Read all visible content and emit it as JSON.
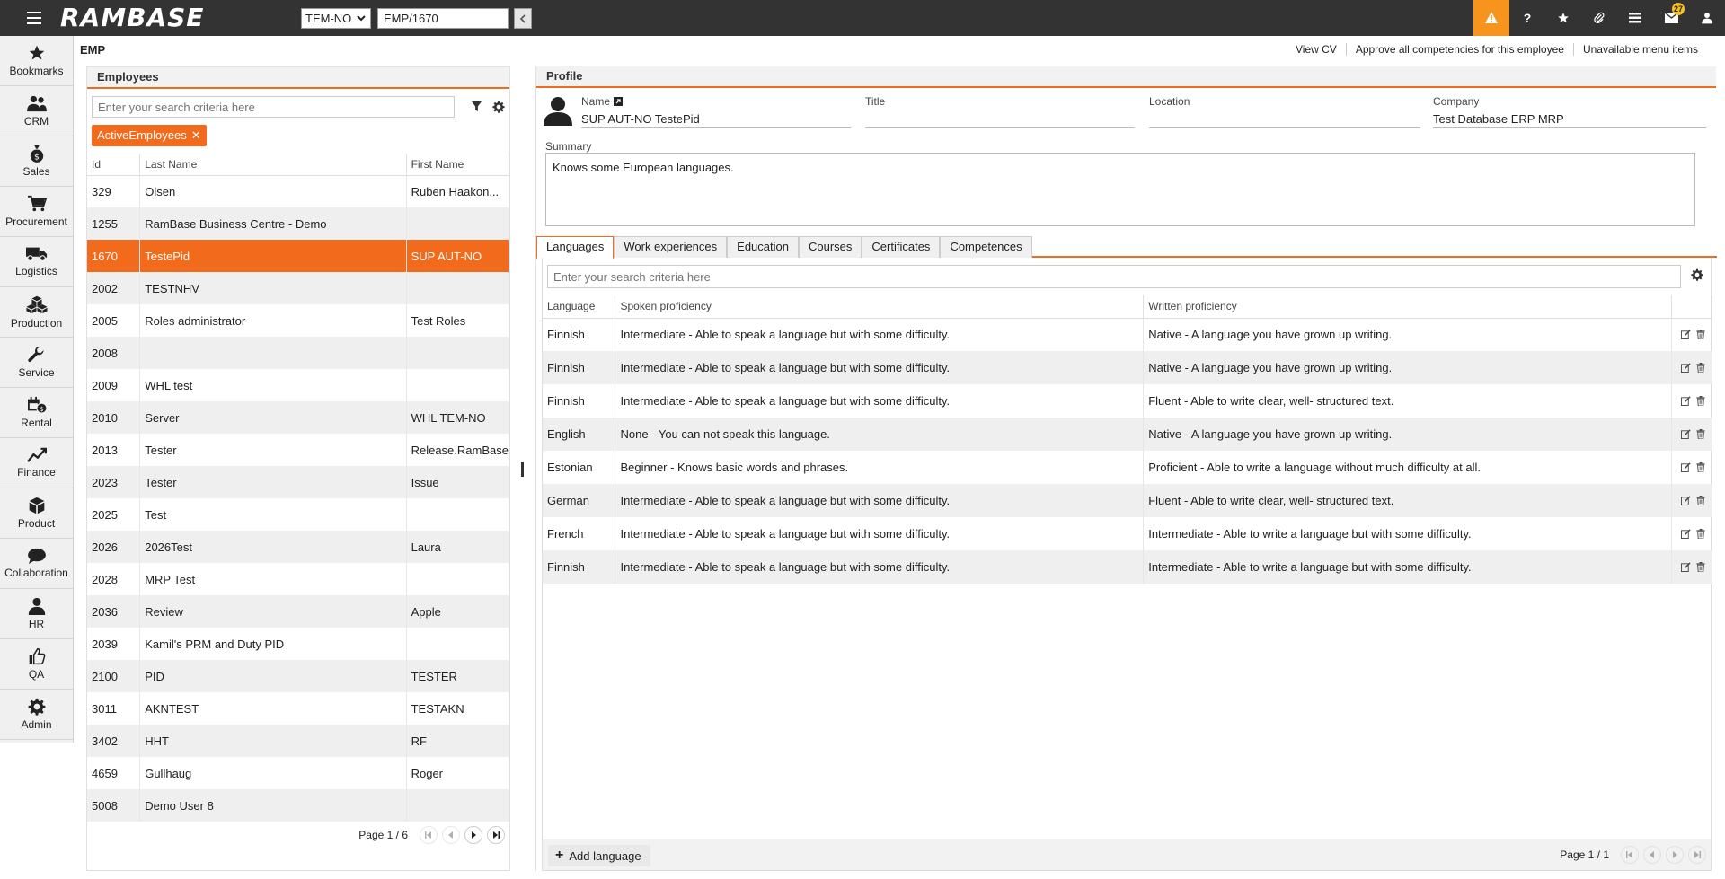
{
  "app": {
    "logo": "RAMBASE",
    "company": "TEM-NO",
    "goto_value": "EMP/1670",
    "notifications_count": "27"
  },
  "nav": [
    {
      "label": "Bookmarks",
      "icon": "star-icon"
    },
    {
      "label": "CRM",
      "icon": "people-icon"
    },
    {
      "label": "Sales",
      "icon": "money-bag-icon"
    },
    {
      "label": "Procurement",
      "icon": "cart-icon"
    },
    {
      "label": "Logistics",
      "icon": "truck-icon"
    },
    {
      "label": "Production",
      "icon": "boxes-icon"
    },
    {
      "label": "Service",
      "icon": "wrench-icon"
    },
    {
      "label": "Rental",
      "icon": "rental-icon"
    },
    {
      "label": "Finance",
      "icon": "chart-icon"
    },
    {
      "label": "Product",
      "icon": "box-icon"
    },
    {
      "label": "Collaboration",
      "icon": "chat-icon"
    },
    {
      "label": "HR",
      "icon": "person-icon"
    },
    {
      "label": "QA",
      "icon": "thumbs-up-icon"
    },
    {
      "label": "Admin",
      "icon": "gear-icon"
    }
  ],
  "page": {
    "code": "EMP",
    "menu_links": [
      "View CV",
      "Approve all competencies for this employee",
      "Unavailable menu items"
    ]
  },
  "employees": {
    "title": "Employees",
    "search_placeholder": "Enter your search criteria here",
    "filter_chip": "ActiveEmployees",
    "columns": [
      "Id",
      "Last Name",
      "First Name"
    ],
    "rows": [
      [
        "329",
        "Olsen",
        "Ruben Haakon..."
      ],
      [
        "1255",
        "RamBase Business Centre - Demo",
        ""
      ],
      [
        "1670",
        "TestePid",
        "SUP AUT-NO"
      ],
      [
        "2002",
        "TESTNHV",
        ""
      ],
      [
        "2005",
        "Roles administrator",
        "Test Roles"
      ],
      [
        "2008",
        "",
        ""
      ],
      [
        "2009",
        "WHL test",
        ""
      ],
      [
        "2010",
        "Server",
        "WHL TEM-NO"
      ],
      [
        "2013",
        "Tester",
        "Release.RamBase"
      ],
      [
        "2023",
        "Tester",
        "Issue"
      ],
      [
        "2025",
        "Test",
        ""
      ],
      [
        "2026",
        "2026Test",
        "Laura"
      ],
      [
        "2028",
        "MRP Test",
        ""
      ],
      [
        "2036",
        "Review",
        "Apple"
      ],
      [
        "2039",
        "Kamil's PRM and Duty PID",
        ""
      ],
      [
        "2100",
        "PID",
        "TESTER"
      ],
      [
        "3011",
        "AKNTEST",
        "TESTAKN"
      ],
      [
        "3402",
        "HHT",
        "RF"
      ],
      [
        "4659",
        "Gullhaug",
        "Roger"
      ],
      [
        "5008",
        "Demo User 8",
        ""
      ]
    ],
    "selected_index": 2,
    "page_text": "Page 1 / 6"
  },
  "profile": {
    "title": "Profile",
    "name_label": "Name",
    "name_value": "SUP AUT-NO TestePid",
    "title_label": "Title",
    "title_value": "",
    "location_label": "Location",
    "location_value": "",
    "company_label": "Company",
    "company_value": "Test Database ERP MRP",
    "summary_label": "Summary",
    "summary_value": "Knows some European languages."
  },
  "tabs": [
    "Languages",
    "Work experiences",
    "Education",
    "Courses",
    "Certificates",
    "Competences"
  ],
  "active_tab": 0,
  "languages": {
    "search_placeholder": "Enter your search criteria here",
    "columns": [
      "Language",
      "Spoken proficiency",
      "Written proficiency"
    ],
    "rows": [
      [
        "Finnish",
        "Intermediate - Able to speak a language but with some difficulty.",
        "Native - A language you have grown up writing."
      ],
      [
        "Finnish",
        "Intermediate - Able to speak a language but with some difficulty.",
        "Native - A language you have grown up writing."
      ],
      [
        "Finnish",
        "Intermediate - Able to speak a language but with some difficulty.",
        "Fluent - Able to write clear, well- structured text."
      ],
      [
        "English",
        "None - You can not speak this language.",
        "Native - A language you have grown up writing."
      ],
      [
        "Estonian",
        "Beginner - Knows basic words and phrases.",
        "Proficient - Able to write a language without much difficulty at all."
      ],
      [
        "German",
        "Intermediate - Able to speak a language but with some difficulty.",
        "Fluent - Able to write clear, well- structured text."
      ],
      [
        "French",
        "Intermediate - Able to speak a language but with some difficulty.",
        "Intermediate - Able to write a language but with some difficulty."
      ],
      [
        "Finnish",
        "Intermediate - Able to speak a language but with some difficulty.",
        "Intermediate - Able to write a language but with some difficulty."
      ]
    ],
    "add_label": "Add language",
    "page_text": "Page 1 / 1"
  },
  "colors": {
    "accent": "#f26b1d",
    "topbar": "#333333",
    "alert": "#f7941d"
  }
}
